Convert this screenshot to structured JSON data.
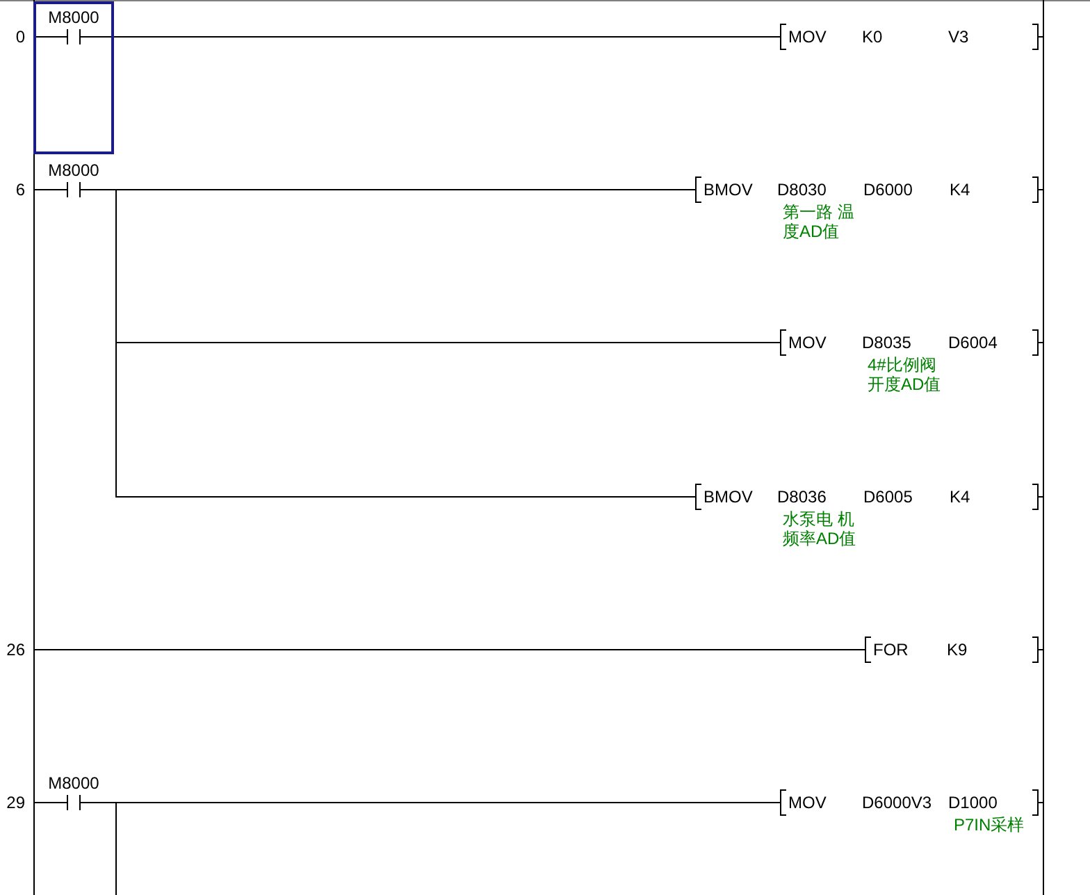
{
  "rungs": [
    {
      "step": "0",
      "selected": true,
      "contacts": [
        {
          "label": "M8000"
        }
      ],
      "outputs": [
        {
          "instruction": "MOV",
          "operands": [
            {
              "value": "K0"
            },
            {
              "value": "V3"
            }
          ]
        }
      ]
    },
    {
      "step": "6",
      "selected": false,
      "contacts": [
        {
          "label": "M8000"
        }
      ],
      "outputs": [
        {
          "instruction": "BMOV",
          "operands": [
            {
              "value": "D8030",
              "comment": [
                "第一路 温",
                "度AD值"
              ]
            },
            {
              "value": "D6000"
            },
            {
              "value": "K4"
            }
          ]
        },
        {
          "instruction": "MOV",
          "operands": [
            {
              "value": "D8035",
              "comment": [
                "4#比例阀",
                "开度AD值"
              ]
            },
            {
              "value": "D6004"
            }
          ]
        },
        {
          "instruction": "BMOV",
          "operands": [
            {
              "value": "D8036",
              "comment": [
                "水泵电 机",
                "频率AD值"
              ]
            },
            {
              "value": "D6005"
            },
            {
              "value": "K4"
            }
          ]
        }
      ]
    },
    {
      "step": "26",
      "selected": false,
      "outputs": [
        {
          "instruction": "FOR",
          "operands": [
            {
              "value": "K9"
            }
          ]
        }
      ]
    },
    {
      "step": "29",
      "selected": false,
      "more_branches_below": true,
      "contacts": [
        {
          "label": "M8000"
        }
      ],
      "outputs": [
        {
          "instruction": "MOV",
          "operands": [
            {
              "value": "D6000V3"
            },
            {
              "value": "D1000",
              "comment": [
                "P7IN采样"
              ]
            }
          ]
        }
      ]
    }
  ]
}
